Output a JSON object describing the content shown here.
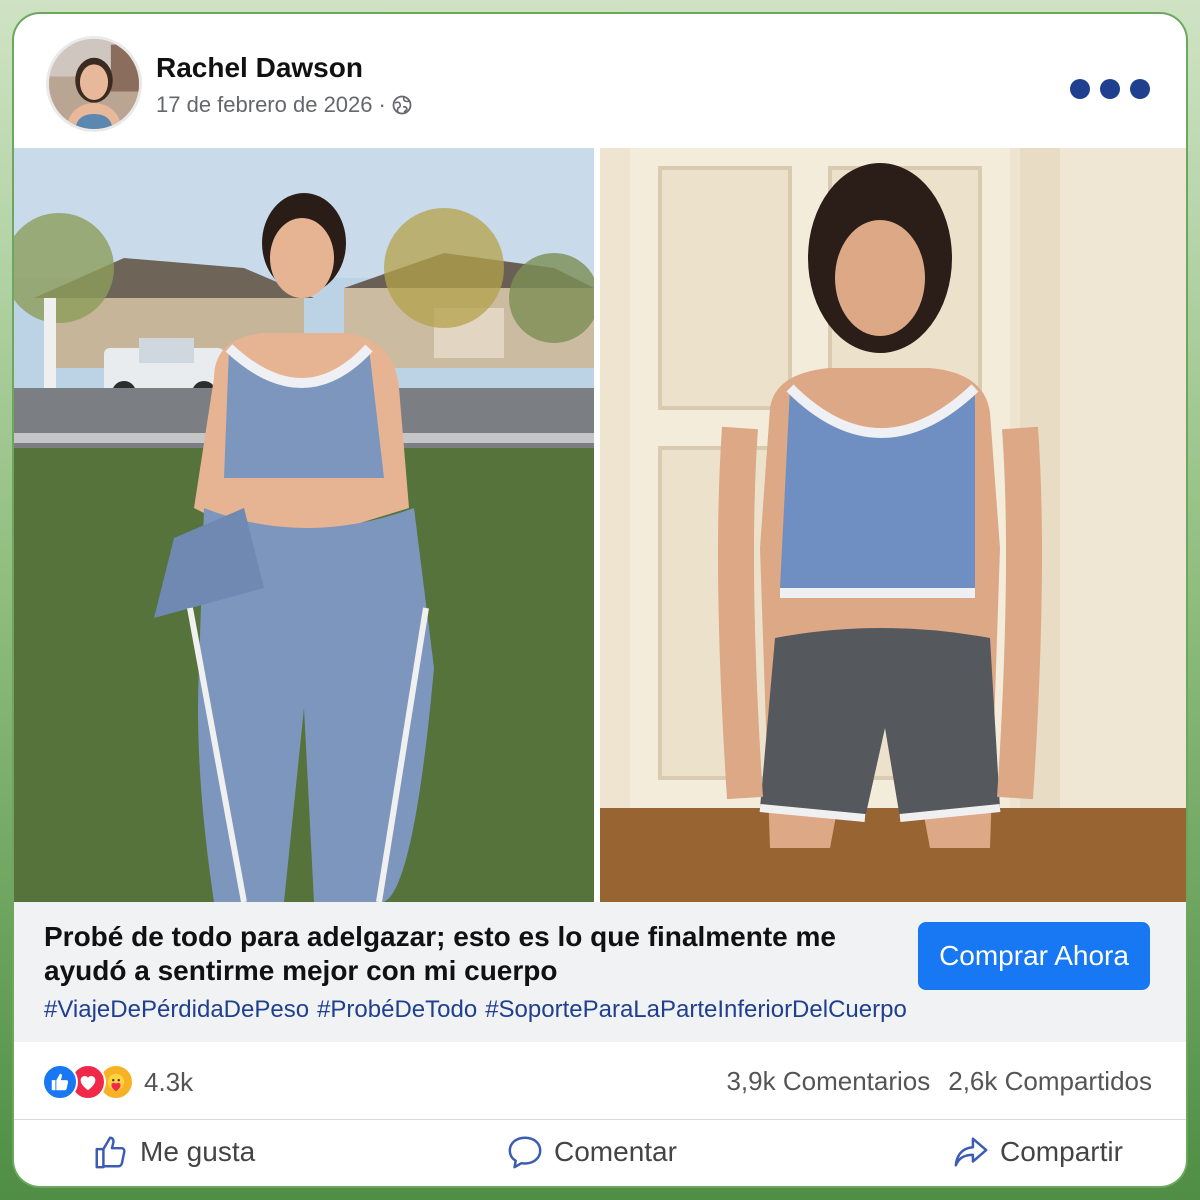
{
  "post": {
    "author": "Rachel Dawson",
    "date": "17 de febrero de 2026",
    "separator": "·",
    "privacy_icon": "globe-icon",
    "more_icon": "more-options-icon"
  },
  "ad": {
    "headline": "Probé de todo para adelgazar; esto es lo que finalmente me ayudó a sentirme mejor con mi cuerpo",
    "cta_label": "Comprar Ahora",
    "hashtags": [
      "#ViajeDePérdidaDePeso",
      "#ProbéDeTodo",
      "#SoporteParaLaParteInferiorDelCuerpo"
    ]
  },
  "stats": {
    "reaction_icons": [
      "like-icon",
      "love-icon",
      "care-icon"
    ],
    "reaction_count": "4.3k",
    "comments": "3,9k Comentarios",
    "shares": "2,6k Compartidos"
  },
  "actions": {
    "like": "Me gusta",
    "comment": "Comentar",
    "share": "Compartir"
  },
  "colors": {
    "brand_blue": "#1877f2",
    "hashtag": "#1f3f8f",
    "love": "#f0284a",
    "care": "#f7b125"
  }
}
